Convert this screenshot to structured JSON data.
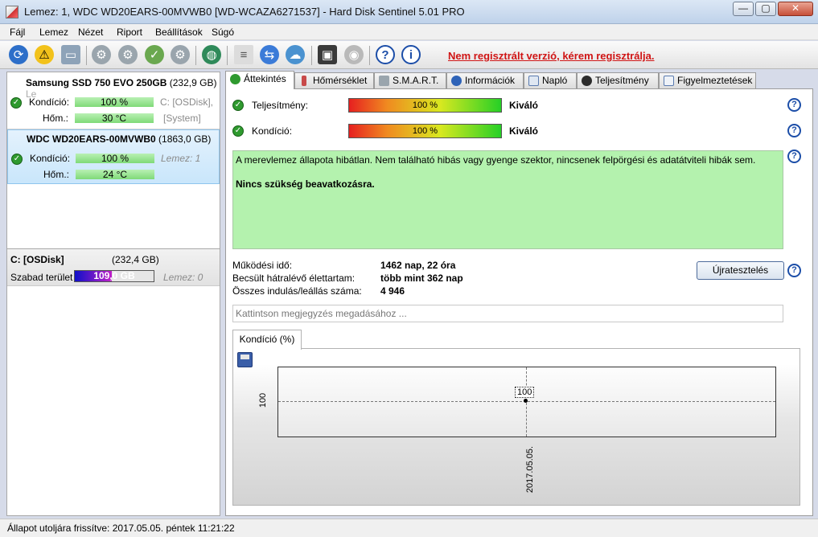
{
  "window": {
    "title": "Lemez: 1, WDC WD20EARS-00MVWB0 [WD-WCAZA6271537]  -  Hard Disk Sentinel 5.01 PRO",
    "min": "—",
    "max": "▢",
    "close": "✕"
  },
  "menu": [
    "Fájl",
    "Lemez",
    "Nézet",
    "Riport",
    "Beállítások",
    "Súgó"
  ],
  "toolbar": {
    "help": "?",
    "info": "i",
    "registration": "Nem regisztrált verzió, kérem regisztrálja."
  },
  "disks": [
    {
      "name": "Samsung SSD 750 EVO 250GB",
      "size": "(232,9 GB)",
      "trunc": "Le",
      "health_label": "Kondíció:",
      "health": "100 %",
      "temp_label": "Hőm.:",
      "temp": "30 °C",
      "side1": "C: [OSDisk],",
      "side2": "[System]"
    },
    {
      "name": "WDC WD20EARS-00MVWB0",
      "size": "(1863,0 GB)",
      "health_label": "Kondíció:",
      "health": "100 %",
      "temp_label": "Hőm.:",
      "temp": "24 °C",
      "side1": "Lemez: 1"
    }
  ],
  "volume": {
    "name": "C: [OSDisk]",
    "size": "(232,4 GB)",
    "free_label": "Szabad terület",
    "free": "109,0 GB",
    "free_fraction": 0.47,
    "side": "Lemez: 0"
  },
  "tabs": [
    "Áttekintés",
    "Hőmérséklet",
    "S.M.A.R.T.",
    "Információk",
    "Napló",
    "Teljesítmény",
    "Figyelmeztetések"
  ],
  "overview": {
    "perf_label": "Teljesítmény:",
    "perf_value": "100 %",
    "perf_rating": "Kiváló",
    "cond_label": "Kondíció:",
    "cond_value": "100 %",
    "cond_rating": "Kiváló",
    "message": "A merevlemez állapota hibátlan. Nem található hibás vagy gyenge szektor, nincsenek felpörgési és adatátviteli hibák sem.",
    "action": "Nincs szükség beavatkozásra.",
    "uptime_label": "Működési idő:",
    "uptime": "1462 nap, 22 óra",
    "life_label": "Becsült hátralévő élettartam:",
    "life": "több mint 362 nap",
    "starts_label": "Összes indulás/leállás száma:",
    "starts": "4 946",
    "retest": "Újratesztelés",
    "note_placeholder": "Kattintson megjegyzés megadásához ...",
    "chart_tab": "Kondíció  (%)"
  },
  "chart_data": {
    "type": "line",
    "x": [
      "2017.05.05."
    ],
    "series": [
      {
        "values": [
          100
        ]
      }
    ],
    "point_label": "100",
    "ytick": "100",
    "xtick": "2017.05.05."
  },
  "status": "Állapot utoljára frissítve: 2017.05.05. péntek 11:21:22"
}
